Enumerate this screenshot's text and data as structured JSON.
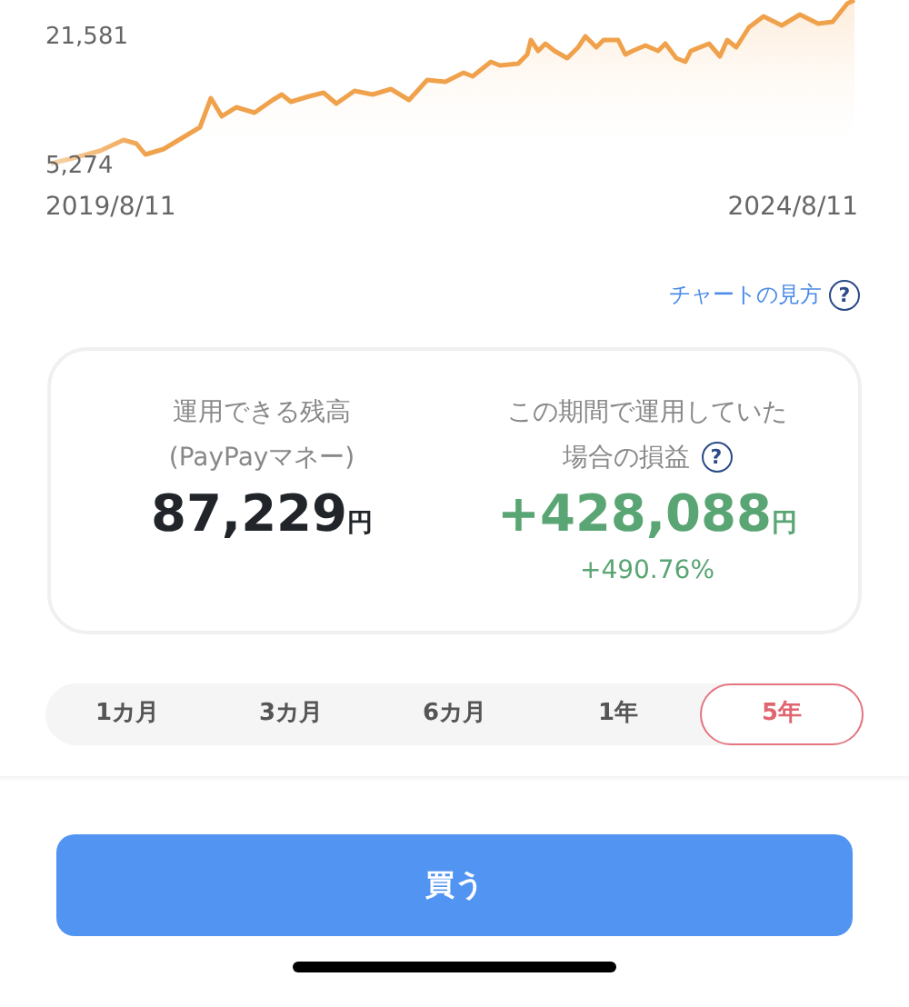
{
  "chart": {
    "y_labels": [
      "21,581",
      "5,274"
    ],
    "x_labels": [
      "2019/8/11",
      "2024/8/11"
    ]
  },
  "help_link": {
    "label": "チャートの見方",
    "icon": "?"
  },
  "summary": {
    "balance": {
      "label_lines": [
        "運用できる残高",
        "(PayPayマネー)"
      ],
      "value": "87,229",
      "unit": "円"
    },
    "profit": {
      "label_lines": [
        "この期間で運用していた",
        "場合の損益"
      ],
      "icon": "?",
      "value": "+428,088",
      "unit": "円",
      "percent": "+490.76%"
    }
  },
  "periods": [
    {
      "label": "1カ月",
      "selected": false
    },
    {
      "label": "3カ月",
      "selected": false
    },
    {
      "label": "6カ月",
      "selected": false
    },
    {
      "label": "1年",
      "selected": false
    },
    {
      "label": "5年",
      "selected": true
    }
  ],
  "buy_button": "買う"
}
